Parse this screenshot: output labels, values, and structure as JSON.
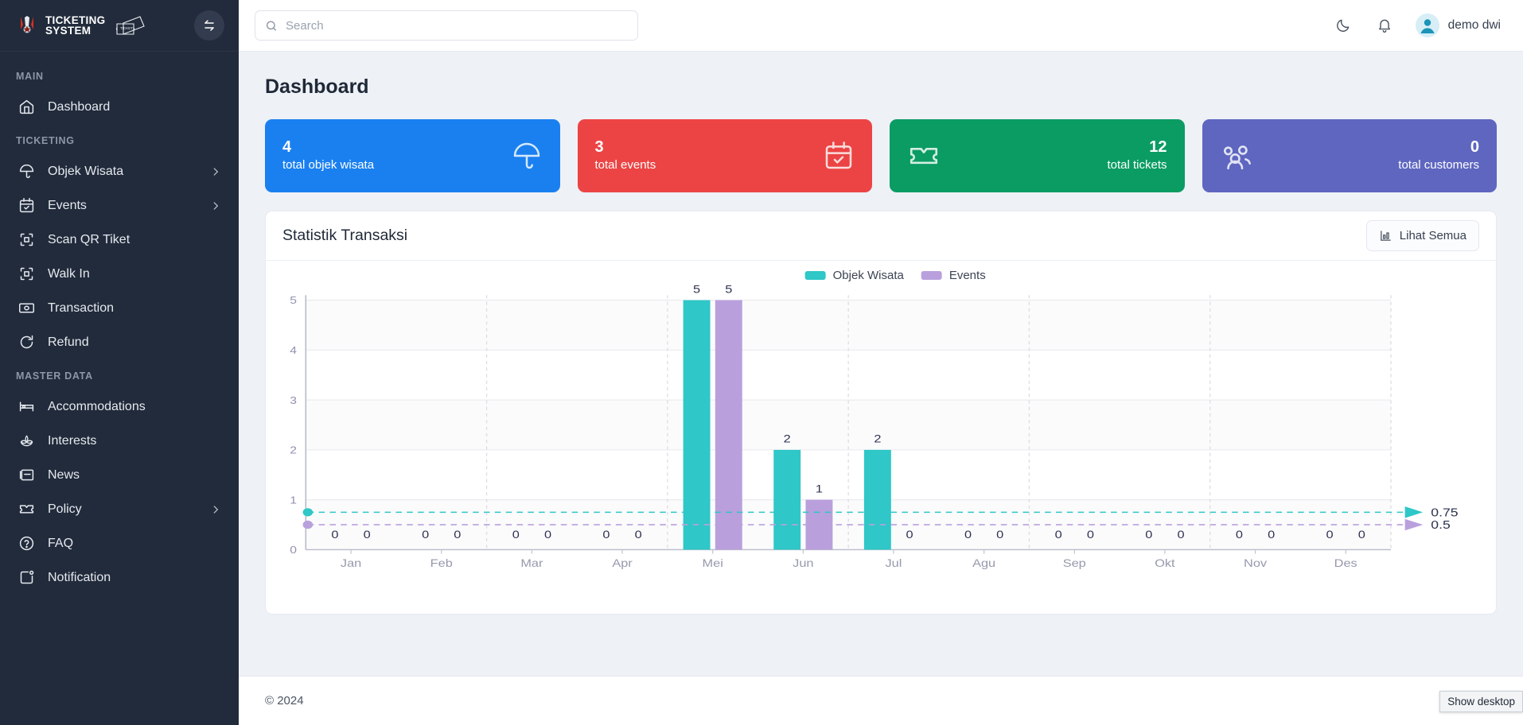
{
  "sidebar": {
    "brand_line1": "TICKETING",
    "brand_line2": "SYSTEM",
    "collapse_icon": "collapse-arrows-icon",
    "sections": [
      {
        "label": "MAIN",
        "items": [
          {
            "label": "Dashboard",
            "icon": "home-icon",
            "chevron": false,
            "active": true
          }
        ]
      },
      {
        "label": "TICKETING",
        "items": [
          {
            "label": "Objek Wisata",
            "icon": "umbrella-icon",
            "chevron": true
          },
          {
            "label": "Events",
            "icon": "calendar-check-icon",
            "chevron": true
          },
          {
            "label": "Scan QR Tiket",
            "icon": "scan-icon",
            "chevron": false
          },
          {
            "label": "Walk In",
            "icon": "scan-frame-icon",
            "chevron": false
          },
          {
            "label": "Transaction",
            "icon": "banknote-icon",
            "chevron": false
          },
          {
            "label": "Refund",
            "icon": "refresh-icon",
            "chevron": false
          }
        ]
      },
      {
        "label": "MASTER DATA",
        "items": [
          {
            "label": "Accommodations",
            "icon": "bed-icon",
            "chevron": false
          },
          {
            "label": "Interests",
            "icon": "lotus-icon",
            "chevron": false
          },
          {
            "label": "News",
            "icon": "newspaper-icon",
            "chevron": false
          },
          {
            "label": "Policy",
            "icon": "ticket-icon",
            "chevron": true
          },
          {
            "label": "FAQ",
            "icon": "question-circle-icon",
            "chevron": false
          },
          {
            "label": "Notification",
            "icon": "notification-square-icon",
            "chevron": false
          }
        ]
      }
    ]
  },
  "topbar": {
    "search_placeholder": "Search",
    "search_value": "",
    "search_icon": "search-icon",
    "theme_icon": "moon-icon",
    "bell_icon": "bell-icon",
    "avatar_icon": "user-avatar-icon",
    "user_name": "demo dwi"
  },
  "page": {
    "title": "Dashboard"
  },
  "stat_cards": [
    {
      "value": "4",
      "label": "total objek wisata",
      "color": "#1a80f0",
      "icon": "umbrella-icon",
      "align": "left"
    },
    {
      "value": "3",
      "label": "total events",
      "color": "#ec4444",
      "icon": "calendar-check-icon",
      "align": "left"
    },
    {
      "value": "12",
      "label": "total tickets",
      "color": "#0b9c63",
      "icon": "ticket-icon",
      "align": "right"
    },
    {
      "value": "0",
      "label": "total customers",
      "color": "#5e66c0",
      "icon": "users-icon",
      "align": "right"
    }
  ],
  "panel": {
    "title": "Statistik Transaksi",
    "action_label": "Lihat Semua",
    "action_icon": "bar-chart-icon"
  },
  "chart_data": {
    "type": "bar",
    "title": "Statistik Transaksi",
    "categories": [
      "Jan",
      "Feb",
      "Mar",
      "Apr",
      "Mei",
      "Jun",
      "Jul",
      "Agu",
      "Sep",
      "Okt",
      "Nov",
      "Des"
    ],
    "series": [
      {
        "name": "Objek Wisata",
        "color": "#2fc7c7",
        "values": [
          0,
          0,
          0,
          0,
          5,
          2,
          2,
          0,
          0,
          0,
          0,
          0
        ]
      },
      {
        "name": "Events",
        "color": "#b9a0dd",
        "values": [
          0,
          0,
          0,
          0,
          5,
          1,
          0,
          0,
          0,
          0,
          0,
          0
        ]
      }
    ],
    "ylim": [
      0,
      5
    ],
    "yticks": [
      0,
      1,
      2,
      3,
      4,
      5
    ],
    "xlabel": "",
    "ylabel": "",
    "grid": true,
    "legend_position": "top-center",
    "annotations": [
      {
        "label": "0.75",
        "value": 0.75,
        "color": "#2fc7c7",
        "style": "dashed-arrow"
      },
      {
        "label": "0.5",
        "value": 0.5,
        "color": "#b9a0dd",
        "style": "dashed-arrow"
      }
    ],
    "data_labels": true
  },
  "footer": {
    "copyright": "© 2024"
  },
  "desktop": {
    "tooltip": "Show desktop"
  }
}
